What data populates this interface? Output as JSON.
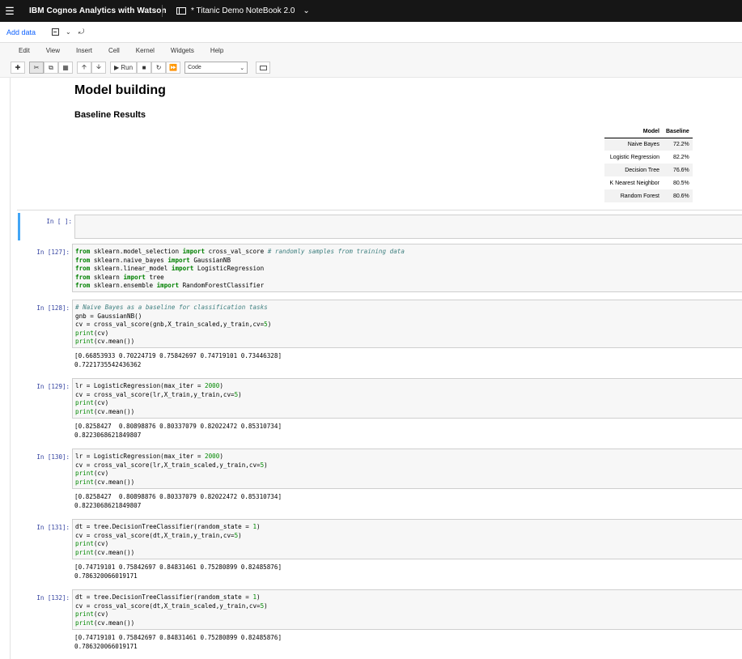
{
  "topbar": {
    "app_title": "IBM Cognos Analytics with Watson",
    "notebook_title": "* Titanic Demo NoteBook 2.0"
  },
  "secbar": {
    "add_data": "Add data"
  },
  "menu": [
    "Edit",
    "View",
    "Insert",
    "Cell",
    "Kernel",
    "Widgets",
    "Help"
  ],
  "toolbar": {
    "run_label": "Run",
    "cell_type": "Code"
  },
  "markdown": {
    "h1": "Model building",
    "h3": "Baseline Results",
    "table_headers": [
      "Model",
      "Baseline"
    ],
    "table_rows": [
      [
        "Naive Bayes",
        "72.2%"
      ],
      [
        "Logistic Regression",
        "82.2%"
      ],
      [
        "Decision Tree",
        "76.6%"
      ],
      [
        "K Nearest Neighbor",
        "80.5%"
      ],
      [
        "Random Forest",
        "80.6%"
      ]
    ]
  },
  "cells": [
    {
      "prompt": "In [ ]:",
      "lines": [],
      "output": []
    },
    {
      "prompt": "In [127]:",
      "lines": [
        "from sklearn.model_selection import cross_val_score # randomly samples from training data",
        "from sklearn.naive_bayes import GaussianNB",
        "from sklearn.linear_model import LogisticRegression",
        "from sklearn import tree",
        "from sklearn.ensemble import RandomForestClassifier"
      ],
      "output": []
    },
    {
      "prompt": "In [128]:",
      "lines": [
        "# Naive Bayes as a baseline for classification tasks",
        "gnb = GaussianNB()",
        "cv = cross_val_score(gnb,X_train_scaled,y_train,cv=5)",
        "print(cv)",
        "print(cv.mean())"
      ],
      "output": [
        "[0.66853933 0.70224719 0.75842697 0.74719101 0.73446328]",
        "0.7221735542436362"
      ]
    },
    {
      "prompt": "In [129]:",
      "lines": [
        "lr = LogisticRegression(max_iter = 2000)",
        "cv = cross_val_score(lr,X_train,y_train,cv=5)",
        "print(cv)",
        "print(cv.mean())"
      ],
      "output": [
        "[0.8258427  0.80898876 0.80337079 0.82022472 0.85310734]",
        "0.8223068621849807"
      ]
    },
    {
      "prompt": "In [130]:",
      "lines": [
        "lr = LogisticRegression(max_iter = 2000)",
        "cv = cross_val_score(lr,X_train_scaled,y_train,cv=5)",
        "print(cv)",
        "print(cv.mean())"
      ],
      "output": [
        "[0.8258427  0.80898876 0.80337079 0.82022472 0.85310734]",
        "0.8223068621849807"
      ]
    },
    {
      "prompt": "In [131]:",
      "lines": [
        "dt = tree.DecisionTreeClassifier(random_state = 1)",
        "cv = cross_val_score(dt,X_train,y_train,cv=5)",
        "print(cv)",
        "print(cv.mean())"
      ],
      "output": [
        "[0.74719101 0.75842697 0.84831461 0.75280899 0.82485876]",
        "0.786320066019171"
      ]
    },
    {
      "prompt": "In [132]:",
      "lines": [
        "dt = tree.DecisionTreeClassifier(random_state = 1)",
        "cv = cross_val_score(dt,X_train_scaled,y_train,cv=5)",
        "print(cv)",
        "print(cv.mean())"
      ],
      "output": [
        "[0.74719101 0.75842697 0.84831461 0.75280899 0.82485876]",
        "0.786320066019171"
      ]
    }
  ]
}
